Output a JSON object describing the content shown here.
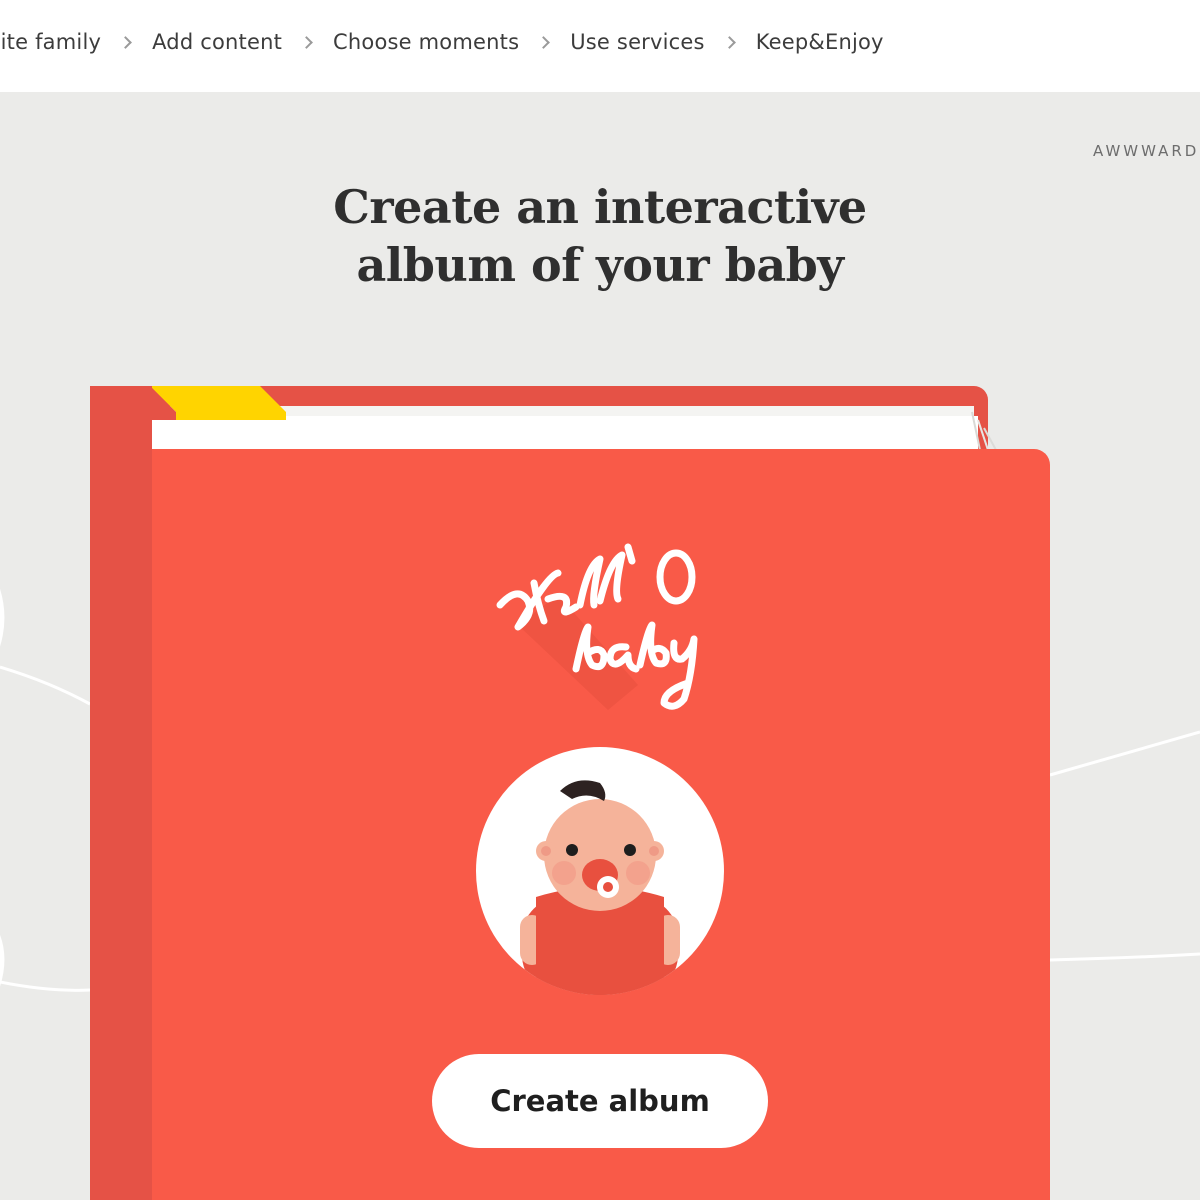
{
  "nav": {
    "steps": [
      {
        "label": "vite family"
      },
      {
        "label": "Add content"
      },
      {
        "label": "Choose moments"
      },
      {
        "label": "Use services"
      },
      {
        "label": "Keep&Enjoy"
      }
    ]
  },
  "badge": {
    "awwwards": "AWWWARDS"
  },
  "hero": {
    "title_line1": "Create an interactive",
    "title_line2": "album of your baby"
  },
  "album": {
    "logo_text": "Hell'O baby",
    "create_label": "Create album"
  },
  "colors": {
    "cover": "#f95a48",
    "spine": "#e55246",
    "bookmark": "#ffd400",
    "background": "#ebebe9"
  }
}
